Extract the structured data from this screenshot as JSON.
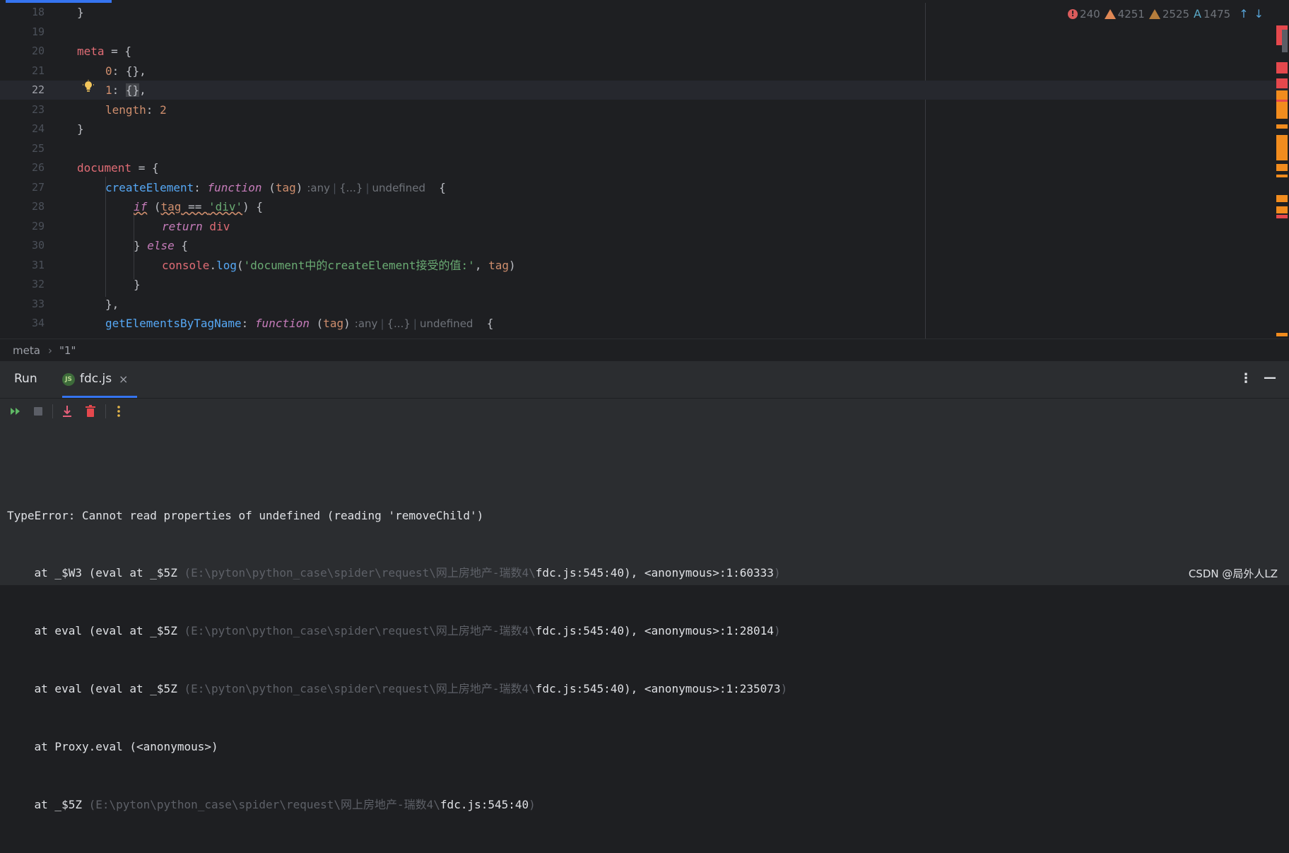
{
  "editor": {
    "lines": [
      {
        "num": "18"
      },
      {
        "num": "19"
      },
      {
        "num": "20"
      },
      {
        "num": "21"
      },
      {
        "num": "22"
      },
      {
        "num": "23"
      },
      {
        "num": "24"
      },
      {
        "num": "25"
      },
      {
        "num": "26"
      },
      {
        "num": "27"
      },
      {
        "num": "28"
      },
      {
        "num": "29"
      },
      {
        "num": "30"
      },
      {
        "num": "31"
      },
      {
        "num": "32"
      },
      {
        "num": "33"
      },
      {
        "num": "34"
      }
    ],
    "code": {
      "l18": "}",
      "l20_var": "meta",
      "l20_rest": " = {",
      "l21_key": "0",
      "l21_rest": ": {},",
      "l22_key": "1",
      "l22_colon": ": ",
      "l22_brace": "{}",
      "l22_rest": ",",
      "l23_key": "length",
      "l23_colon": ": ",
      "l23_num": "2",
      "l24": "}",
      "l26_var": "document",
      "l26_rest": " = {",
      "l27_fn": "createElement",
      "l27_colon": ": ",
      "l27_kw": "function",
      "l27_open": " (",
      "l27_param": "tag",
      "l27_close": ")",
      "l27_brace": "  {",
      "l28_kw": "if",
      "l28_open": " (",
      "l28_param": "tag",
      "l28_op": " == ",
      "l28_str": "'div'",
      "l28_rest": ") {",
      "l29_kw": "return",
      "l29_var": " div",
      "l30_close": "} ",
      "l30_kw": "else",
      "l30_rest": " {",
      "l31_var": "console",
      "l31_dot": ".",
      "l31_fn": "log",
      "l31_open": "(",
      "l31_str": "'document中的createElement接受的值:'",
      "l31_comma": ", ",
      "l31_param": "tag",
      "l31_close": ")",
      "l32": "}",
      "l33": "},",
      "l34_fn": "getElementsByTagName",
      "l34_colon": ": ",
      "l34_kw": "function",
      "l34_open": " (",
      "l34_param": "tag",
      "l34_close": ")",
      "l34_brace": "  {"
    },
    "type_hint": {
      "label": ":any",
      "mid": "{...}",
      "last": "undefined"
    }
  },
  "inspections": {
    "errors": "240",
    "warnings": "4251",
    "weak_warnings": "2525",
    "typos": "1475",
    "error_glyph": "!",
    "typo_glyph": "A",
    "up_glyph": "↑",
    "down_glyph": "↓"
  },
  "breadcrumb": {
    "item1": "meta",
    "separator": "›",
    "item2": "\"1\""
  },
  "run_panel": {
    "title": "Run",
    "tab_label": "fdc.js",
    "tab_icon_text": "JS",
    "close_glyph": "×",
    "more_glyph": "⋮",
    "minimize_glyph": "—"
  },
  "console": {
    "error": "TypeError: Cannot read properties of undefined (reading 'removeChild')",
    "frames": [
      {
        "pre": "    at _$W3 (eval at _$5Z ",
        "path": "(E:\\pyton\\python_case\\spider\\request\\网上房地产-瑞数4\\",
        "file": "fdc.js:545:40), <anonymous>:1:60333",
        "tail": ")"
      },
      {
        "pre": "    at eval (eval at _$5Z ",
        "path": "(E:\\pyton\\python_case\\spider\\request\\网上房地产-瑞数4\\",
        "file": "fdc.js:545:40), <anonymous>:1:28014",
        "tail": ")"
      },
      {
        "pre": "    at eval (eval at _$5Z ",
        "path": "(E:\\pyton\\python_case\\spider\\request\\网上房地产-瑞数4\\",
        "file": "fdc.js:545:40), <anonymous>:1:235073",
        "tail": ")"
      },
      {
        "pre": "    at Proxy.eval (<anonymous>)",
        "path": "",
        "file": "",
        "tail": ""
      },
      {
        "pre": "    at _$5Z ",
        "path": "(E:\\pyton\\python_case\\spider\\request\\网上房地产-瑞数4\\",
        "file": "fdc.js:545:40",
        "tail": ")"
      }
    ]
  },
  "watermark": "CSDN @局外人LZ",
  "colors": {
    "accent": "#3574f0",
    "error": "#db5c5c",
    "warning": "#e08855",
    "scroll_error": "#e5484d",
    "scroll_warning": "#f28c1e"
  }
}
